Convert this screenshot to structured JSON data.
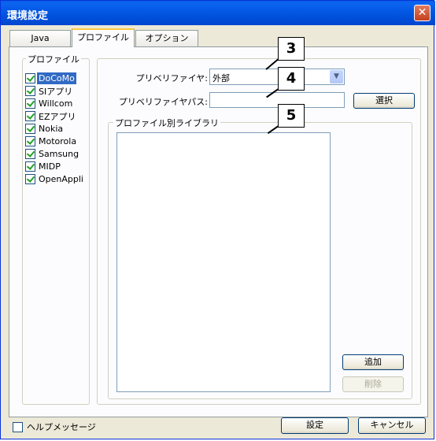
{
  "window": {
    "title": "環境設定",
    "close_glyph": "✕"
  },
  "tabs": [
    {
      "label": "Java"
    },
    {
      "label": "プロファイル"
    },
    {
      "label": "オプション"
    }
  ],
  "profile_group": {
    "label": "プロファイル",
    "items": [
      {
        "label": "DoCoMo",
        "checked": true,
        "selected": true
      },
      {
        "label": "SIアプリ",
        "checked": true
      },
      {
        "label": "Willcom",
        "checked": true
      },
      {
        "label": "EZアプリ",
        "checked": true
      },
      {
        "label": "Nokia",
        "checked": true
      },
      {
        "label": "Motorola",
        "checked": true
      },
      {
        "label": "Samsung",
        "checked": true
      },
      {
        "label": "MIDP",
        "checked": true
      },
      {
        "label": "OpenAppli",
        "checked": true
      }
    ]
  },
  "settings": {
    "preverifier_label": "プリベリファイヤ:",
    "preverifier_value": "外部",
    "preverifier_path_label": "プリベリファイヤパス:",
    "preverifier_path_value": "",
    "browse_label": "選択"
  },
  "library_group": {
    "label": "プロファイル別ライブラリ",
    "add_label": "追加",
    "remove_label": "削除"
  },
  "callouts": [
    "3",
    "4",
    "5"
  ],
  "footer": {
    "help_message_label": "ヘルプメッセージ",
    "ok_label": "設定",
    "cancel_label": "キャンセル"
  }
}
